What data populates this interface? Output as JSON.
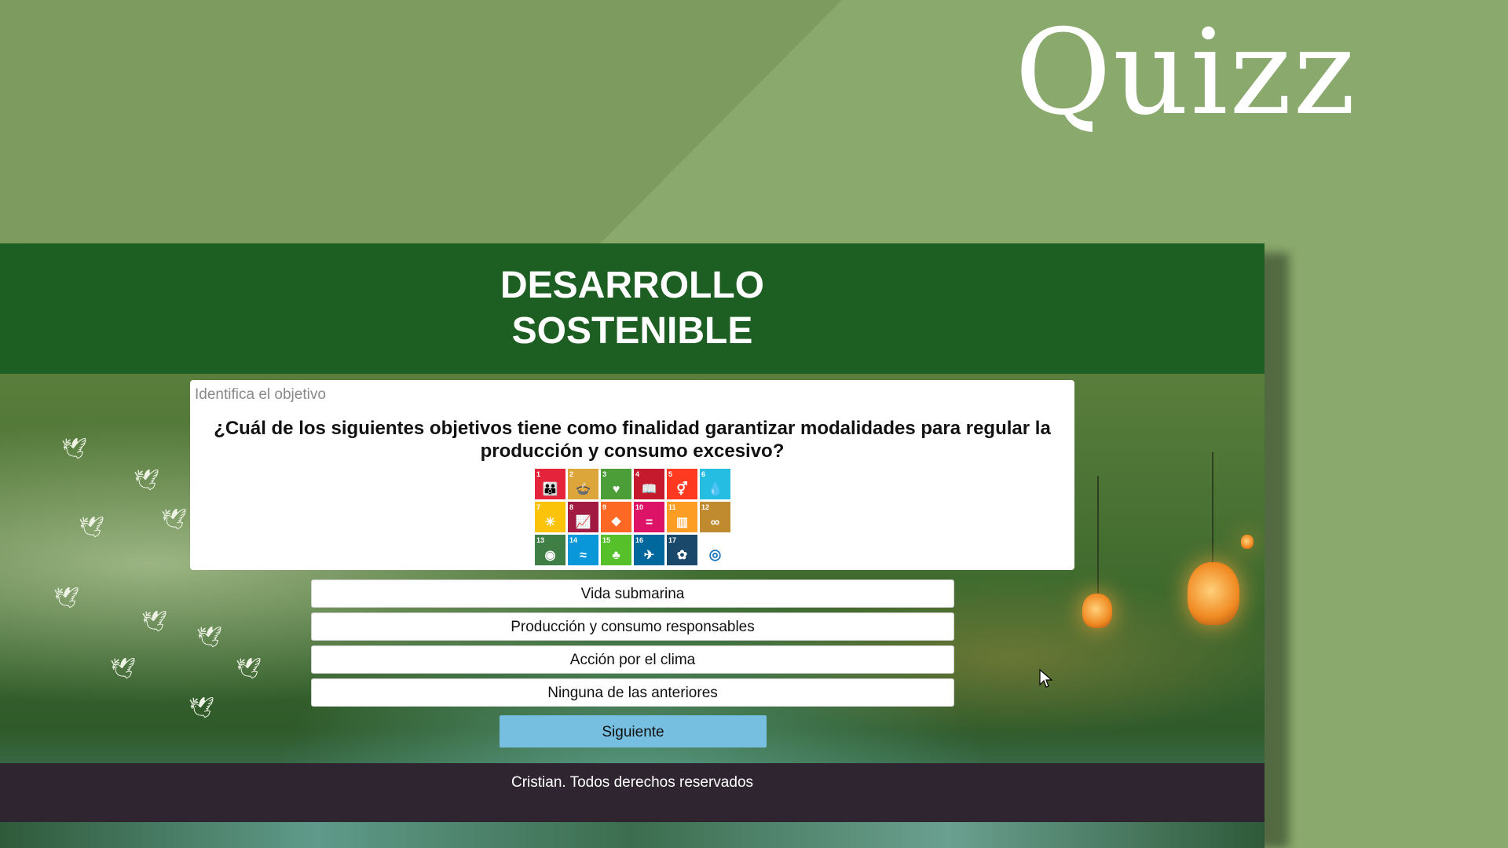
{
  "brand": {
    "quizz_title": "Quizz"
  },
  "header": {
    "title_line1": "DESARROLLO",
    "title_line2": "SOSTENIBLE"
  },
  "question_card": {
    "label": "Identifica el objetivo",
    "question": "¿Cuál de los siguientes objetivos tiene como finalidad garantizar modalidades para regular la producción y consumo excesivo?"
  },
  "sdg_tiles": [
    {
      "num": "1",
      "color": "#e5243b",
      "icon": "people-icon"
    },
    {
      "num": "2",
      "color": "#dda63a",
      "icon": "bowl-icon"
    },
    {
      "num": "3",
      "color": "#4c9f38",
      "icon": "heartbeat-icon"
    },
    {
      "num": "4",
      "color": "#c5192d",
      "icon": "book-icon"
    },
    {
      "num": "5",
      "color": "#ff3a21",
      "icon": "gender-icon"
    },
    {
      "num": "6",
      "color": "#26bde2",
      "icon": "water-drop-icon"
    },
    {
      "num": "7",
      "color": "#fcc30b",
      "icon": "sun-icon"
    },
    {
      "num": "8",
      "color": "#a21942",
      "icon": "growth-chart-icon"
    },
    {
      "num": "9",
      "color": "#fd6925",
      "icon": "cubes-icon"
    },
    {
      "num": "10",
      "color": "#dd1367",
      "icon": "equal-icon"
    },
    {
      "num": "11",
      "color": "#fd9d24",
      "icon": "buildings-icon"
    },
    {
      "num": "12",
      "color": "#bf8b2e",
      "icon": "infinity-icon"
    },
    {
      "num": "13",
      "color": "#3f7e44",
      "icon": "eye-globe-icon"
    },
    {
      "num": "14",
      "color": "#0a97d9",
      "icon": "fish-icon"
    },
    {
      "num": "15",
      "color": "#56c02b",
      "icon": "tree-icon"
    },
    {
      "num": "16",
      "color": "#00689d",
      "icon": "dove-icon"
    },
    {
      "num": "17",
      "color": "#19486a",
      "icon": "flower-icon"
    },
    {
      "num": "",
      "color": "#ffffff",
      "icon": "sdg-logo-icon"
    }
  ],
  "answers": [
    "Vida submarina",
    "Producción y consumo responsables",
    "Acción por el clima",
    "Ninguna de las anteriores"
  ],
  "next_button": "Siguiente",
  "footer": {
    "text": "Cristian. Todos derechos reservados"
  }
}
